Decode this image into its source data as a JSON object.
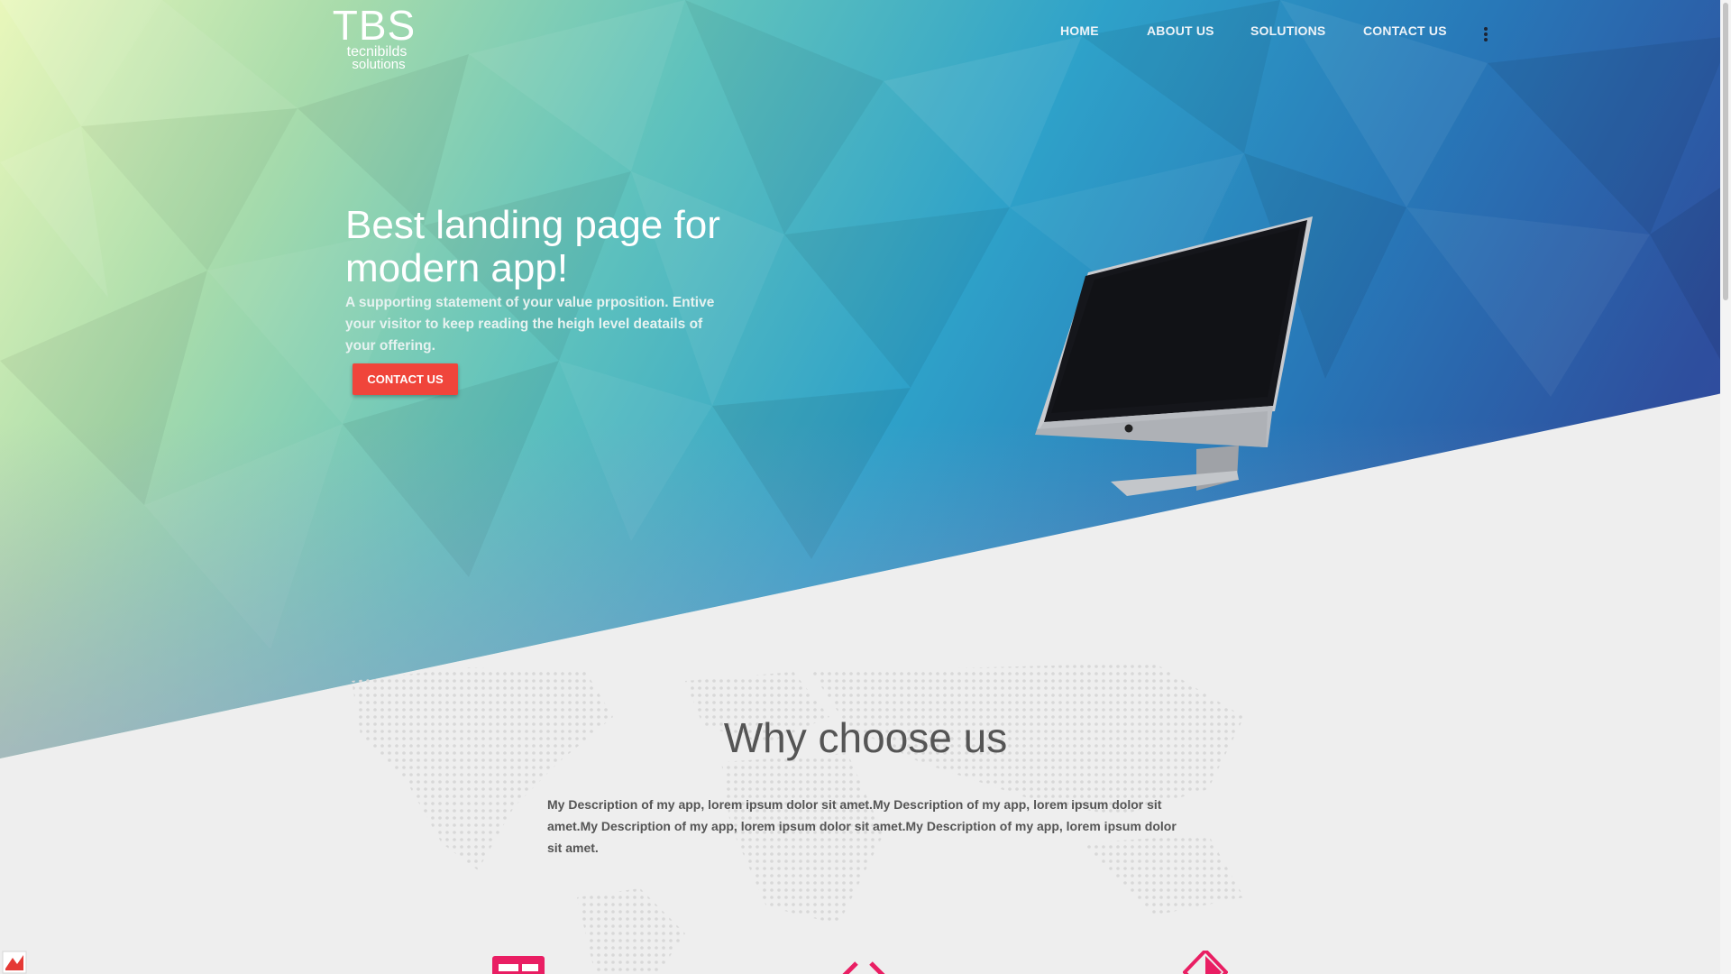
{
  "brand": {
    "logo_mark": "TBS",
    "logo_line1": "tecnibilds",
    "logo_line2": "solutions"
  },
  "nav": {
    "home": "HOME",
    "about": "ABOUT US",
    "solutions": "SOLUTIONS",
    "contact": "CONTACT US",
    "more_icon": "vertical-dots-icon"
  },
  "hero": {
    "title": "Best landing page for modern app!",
    "subtitle": "A supporting statement of your value prposition. Entive your visitor to keep reading the heigh level deatails of your offering.",
    "cta_label": "CONTACT US",
    "illustration": "imac-monitor"
  },
  "why": {
    "title": "Why choose us",
    "description": "My Description of my app, lorem ipsum dolor sit amet.My Description of my app, lorem ipsum dolor sit amet.My Description of my app, lorem ipsum dolor sit amet.My Description of my app, lorem ipsum dolor sit amet."
  },
  "features": {
    "icons": [
      "browser-window-icon",
      "code-brackets-icon",
      "diamond-icon"
    ]
  },
  "colors": {
    "accent": "#f0453b",
    "feature_icon": "#e91e63",
    "heading": "#555555",
    "section_bg": "#eeeeee",
    "hero_gradient": [
      "#e9f7bb",
      "#5fc2bd",
      "#2ea1c9",
      "#2e4f9e"
    ]
  }
}
